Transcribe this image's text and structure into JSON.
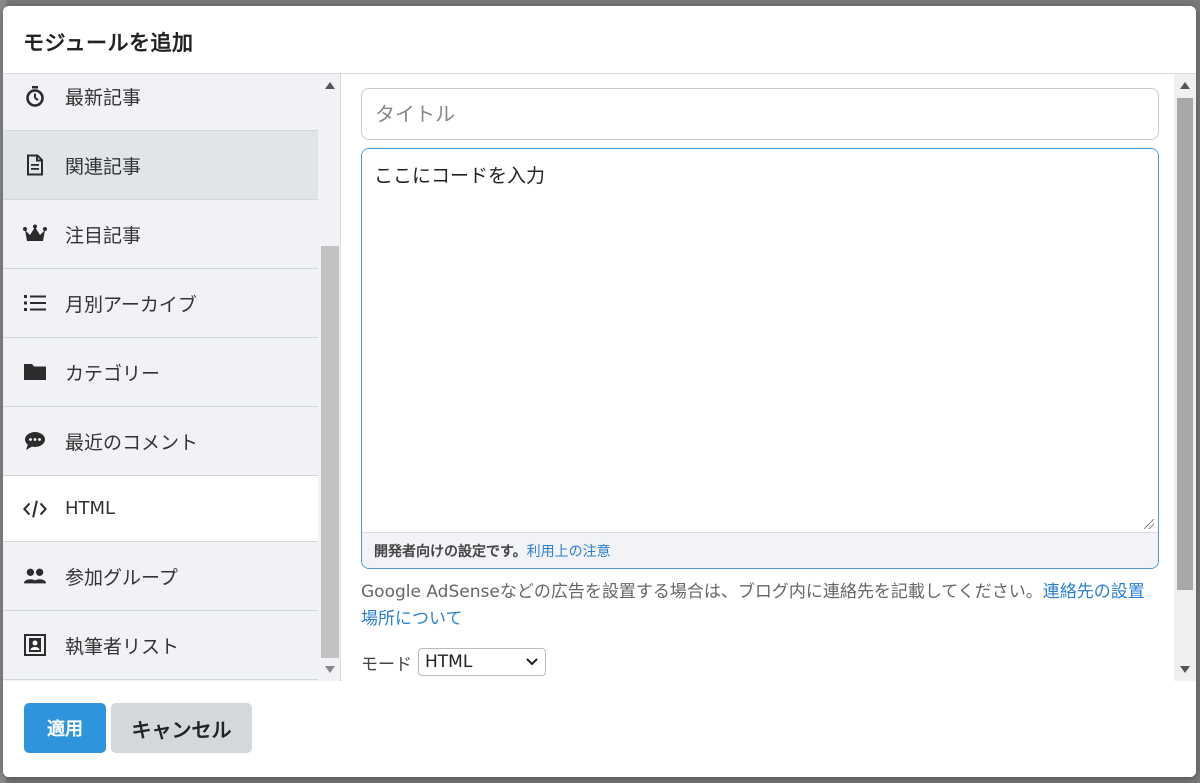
{
  "dialog": {
    "title": "モジュールを追加"
  },
  "menu": {
    "items": [
      {
        "label": "最新記事",
        "icon": "stopwatch-icon"
      },
      {
        "label": "関連記事",
        "icon": "document-icon"
      },
      {
        "label": "注目記事",
        "icon": "crown-icon"
      },
      {
        "label": "月別アーカイブ",
        "icon": "list-icon"
      },
      {
        "label": "カテゴリー",
        "icon": "folder-icon"
      },
      {
        "label": "最近のコメント",
        "icon": "comment-icon"
      },
      {
        "label": "HTML",
        "icon": "code-icon"
      },
      {
        "label": "参加グループ",
        "icon": "group-icon"
      },
      {
        "label": "執筆者リスト",
        "icon": "author-card-icon"
      }
    ],
    "active_item": "HTML",
    "hover_item": "関連記事"
  },
  "form": {
    "title_placeholder": "タイトル",
    "code_value": "ここにコードを入力",
    "note_text": "開発者向けの設定です。",
    "note_link": "利用上の注意",
    "adsense_text": "Google AdSenseなどの広告を設置する場合は、ブログ内に連絡先を記載してください。",
    "adsense_link": "連絡先の設置場所について",
    "mode_label": "モード",
    "mode_value": "HTML"
  },
  "footer": {
    "apply_label": "適用",
    "cancel_label": "キャンセル"
  },
  "colors": {
    "accent": "#2e95dc",
    "link": "#2a7fd4",
    "menu_bg": "#f0f2f5"
  }
}
